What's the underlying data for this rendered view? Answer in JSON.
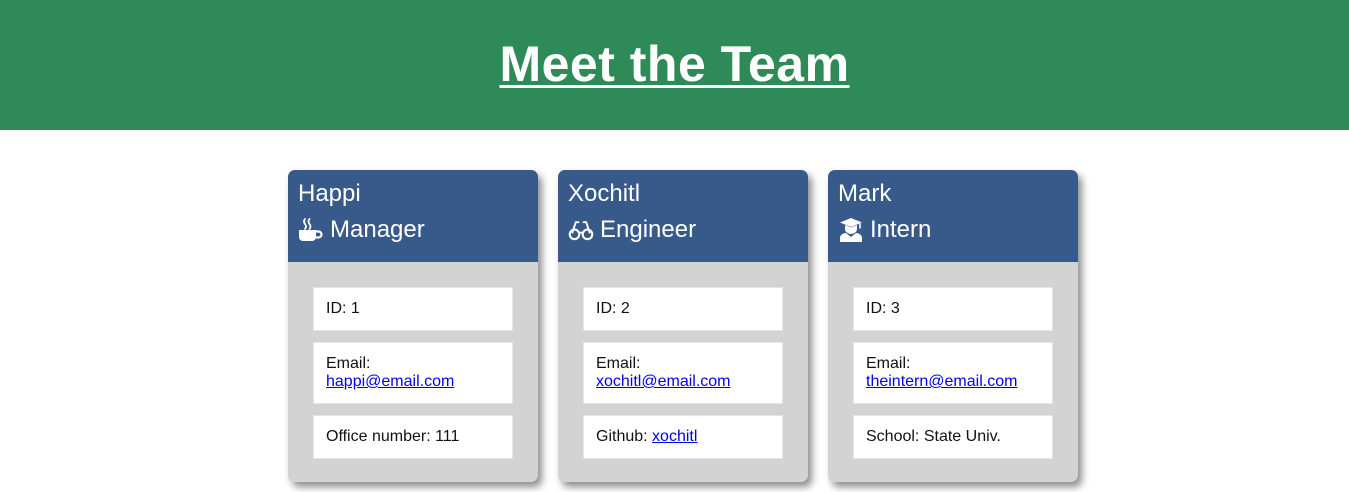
{
  "header": {
    "title": "Meet the Team"
  },
  "team": [
    {
      "name": "Happi",
      "role": "Manager",
      "role_icon": "coffee-mug-icon",
      "id_label": "ID:",
      "id": "1",
      "email_label": "Email:",
      "email": "happi@email.com",
      "extra_label": "Office number:",
      "extra_value": "111"
    },
    {
      "name": "Xochitl",
      "role": "Engineer",
      "role_icon": "glasses-icon",
      "id_label": "ID:",
      "id": "2",
      "email_label": "Email:",
      "email": "xochitl@email.com",
      "extra_label": "Github:",
      "extra_value": "xochitl"
    },
    {
      "name": "Mark",
      "role": "Intern",
      "role_icon": "graduate-icon",
      "id_label": "ID:",
      "id": "3",
      "email_label": "Email:",
      "email": "theintern@email.com",
      "extra_label": "School:",
      "extra_value": "State Univ."
    }
  ],
  "colors": {
    "header_bg": "#2e8b57",
    "card_head_bg": "#375a8b",
    "card_body_bg": "#d3d3d3",
    "link": "#0000ee"
  }
}
